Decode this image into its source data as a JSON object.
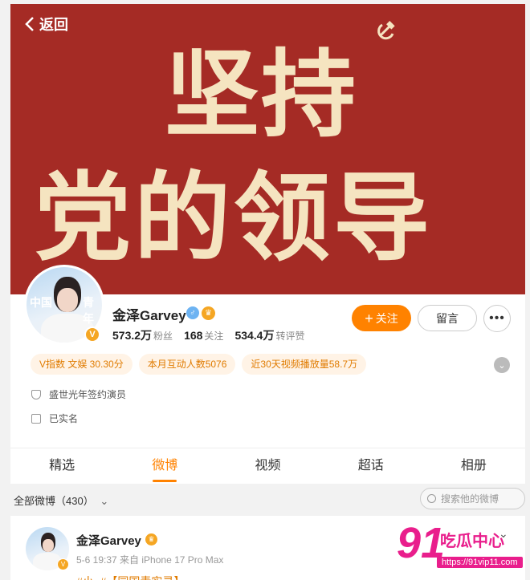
{
  "nav": {
    "back_label": "返回"
  },
  "banner": {
    "line1": "坚持",
    "line2": "党的领导"
  },
  "profile": {
    "name": "金泽Garvey",
    "avatar_text_left": "中国",
    "avatar_text_right": "青年",
    "gender_symbol": "♂",
    "stats": [
      {
        "value": "573.2万",
        "label": "粉丝"
      },
      {
        "value": "168",
        "label": "关注"
      },
      {
        "value": "534.4万",
        "label": "转评赞"
      }
    ],
    "follow_label": "关注",
    "message_label": "留言",
    "more_label": "•••",
    "tags": [
      "V指数 文娱 30.30分",
      "本月互动人数5076",
      "近30天视频播放量58.7万"
    ],
    "info": [
      {
        "icon": "shield-icon",
        "text": "盛世光年签约演员"
      },
      {
        "icon": "id-card-icon",
        "text": "已实名"
      }
    ]
  },
  "tabs": [
    "精选",
    "微博",
    "视频",
    "超话",
    "相册"
  ],
  "active_tab": "微博",
  "feed": {
    "filter_label": "全部微博（430）",
    "search_placeholder": "搜索他的微博"
  },
  "post": {
    "author": "金泽Garvey",
    "meta": "5-6 19:37  来自 iPhone 17 Pro Max",
    "text": "#小..#【同国青实录】"
  },
  "watermark": {
    "number": "91",
    "brand": "吃瓜中心",
    "url": "https://91vip11.com"
  },
  "colors": {
    "banner": "#a52b25",
    "accent": "#ff8200",
    "slogan": "#f5e4c0"
  }
}
